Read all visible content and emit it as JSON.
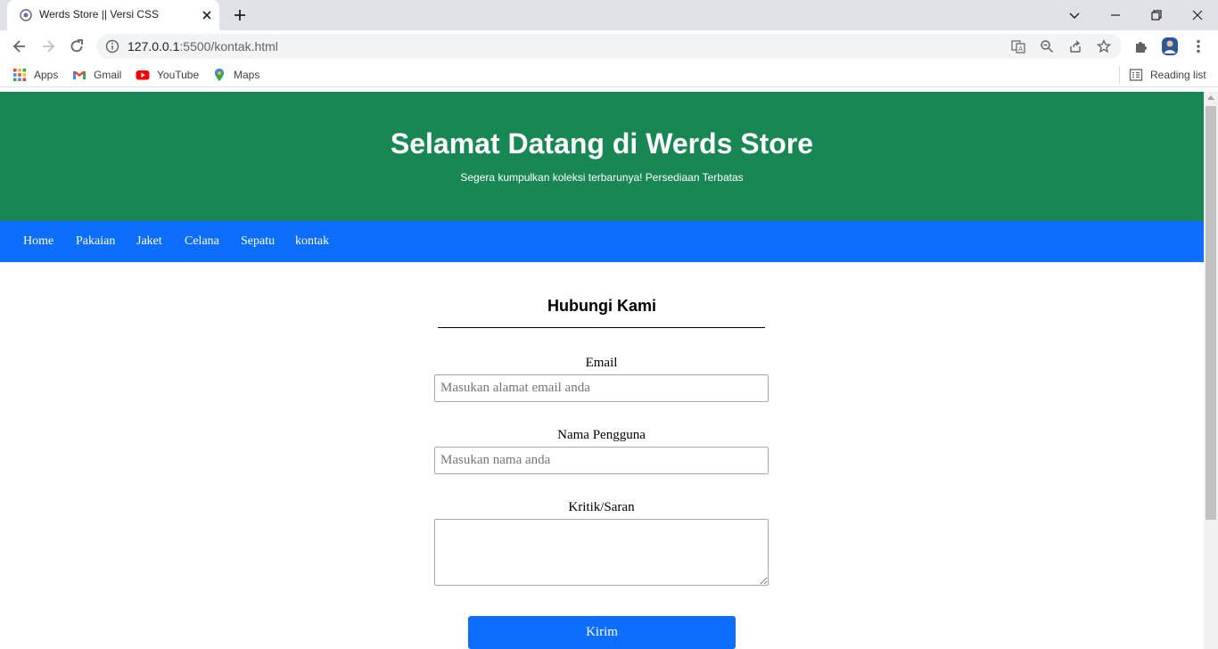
{
  "browser": {
    "tab_title": "Werds Store || Versi CSS",
    "url_host": "127.0.0.1",
    "url_path": ":5500/kontak.html",
    "bookmarks": [
      {
        "label": "Apps",
        "icon": "apps-grid-icon"
      },
      {
        "label": "Gmail",
        "icon": "gmail-icon"
      },
      {
        "label": "YouTube",
        "icon": "youtube-icon"
      },
      {
        "label": "Maps",
        "icon": "maps-icon"
      }
    ],
    "reading_list": "Reading list"
  },
  "hero": {
    "title": "Selamat Datang di Werds Store",
    "subtitle": "Segera kumpulkan koleksi terbarunya! Persediaan Terbatas",
    "color": "#198754"
  },
  "nav": {
    "color": "#0d6efd",
    "items": [
      "Home",
      "Pakaian",
      "Jaket",
      "Celana",
      "Sepatu",
      "kontak"
    ]
  },
  "form": {
    "title": "Hubungi Kami",
    "email_label": "Email",
    "email_placeholder": "Masukan alamat email anda",
    "name_label": "Nama Pengguna",
    "name_placeholder": "Masukan nama anda",
    "feedback_label": "Kritik/Saran",
    "submit_label": "Kirim"
  }
}
